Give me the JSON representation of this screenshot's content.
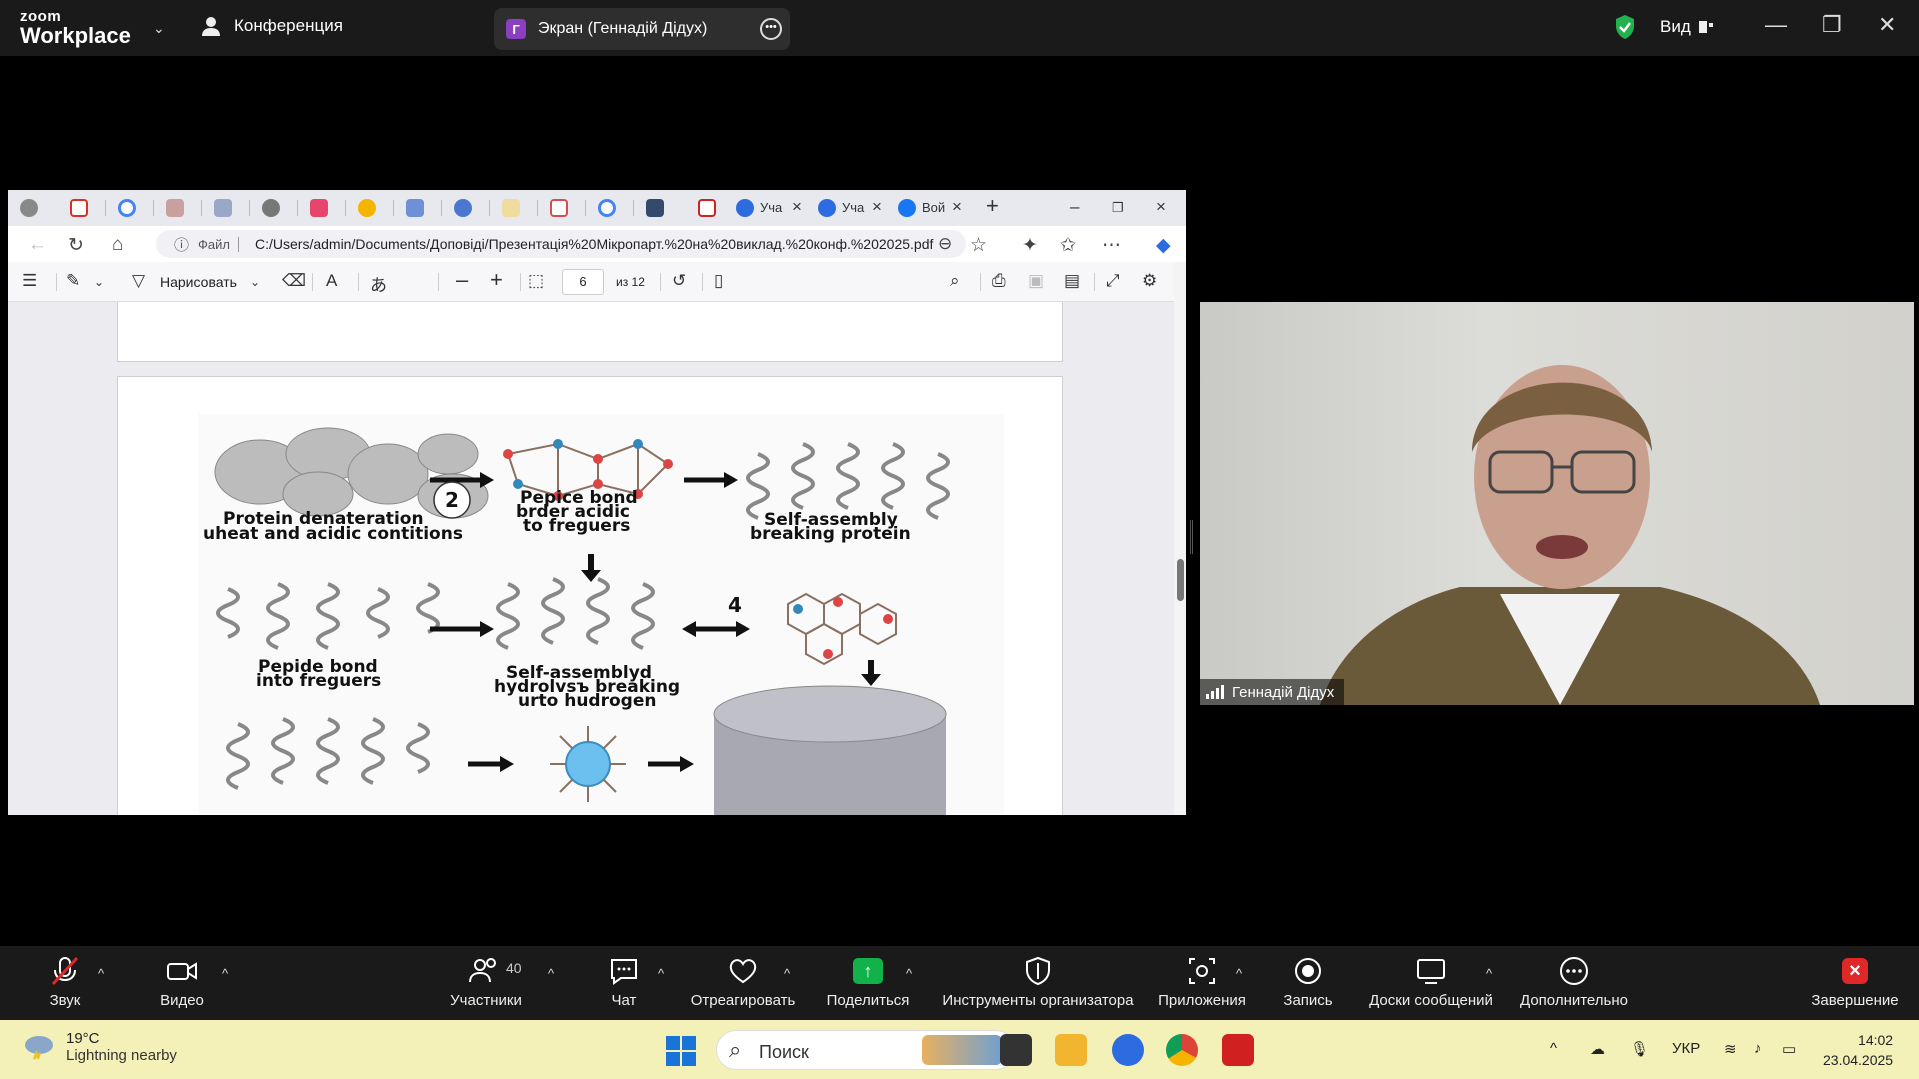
{
  "zoom": {
    "brand_top": "zoom",
    "brand_bottom": "Workplace",
    "meeting_label": "Конференция",
    "share_avatar": "Г",
    "share_label": "Экран (Геннадій Дідух)",
    "view_label": "Вид",
    "participant_name": "Геннадій Дідух",
    "participant_count": "40",
    "toolbar": {
      "audio": "Звук",
      "video": "Видео",
      "participants": "Участники",
      "chat": "Чат",
      "react": "Отреагировать",
      "share": "Поделиться",
      "host_tools": "Инструменты организатора",
      "apps": "Приложения",
      "record": "Запись",
      "whiteboards": "Доски сообщений",
      "more": "Дополнительно",
      "end": "Завершение"
    }
  },
  "browser": {
    "tabs": [
      {
        "label": "Уча"
      },
      {
        "label": "Уча"
      },
      {
        "label": "Вой"
      }
    ],
    "address": {
      "scheme_label": "Файл",
      "url": "C:/Users/admin/Documents/Доповіді/Презентація%20Мікропарт.%20на%20виклад.%20конф.%202025.pdf"
    },
    "pdf_toolbar": {
      "draw_label": "Нарисовать",
      "page_current": "6",
      "page_total": "из 12"
    }
  },
  "figure": {
    "step2": "2",
    "step4": "4",
    "labels": {
      "denaturation_1": "Protein denateration",
      "denaturation_2": "uheat and acidic contitions",
      "bond_1": "Pepice bond",
      "bond_2": "brder acidic",
      "bond_3": "to freguers",
      "self_1": "Self-assembly",
      "self_2": "breaking protein",
      "pepide_1": "Pepide bond",
      "pepide_2": "into freguers",
      "hydro_1": "Self-assemblyd",
      "hydro_2": "hydrolvsъ breaking",
      "hydro_3": "urto hudrogen"
    }
  },
  "taskbar": {
    "temperature": "19°C",
    "weather_text": "Lightning nearby",
    "search_label": "Поиск",
    "language": "УКР",
    "time": "14:02",
    "date": "23.04.2025"
  }
}
